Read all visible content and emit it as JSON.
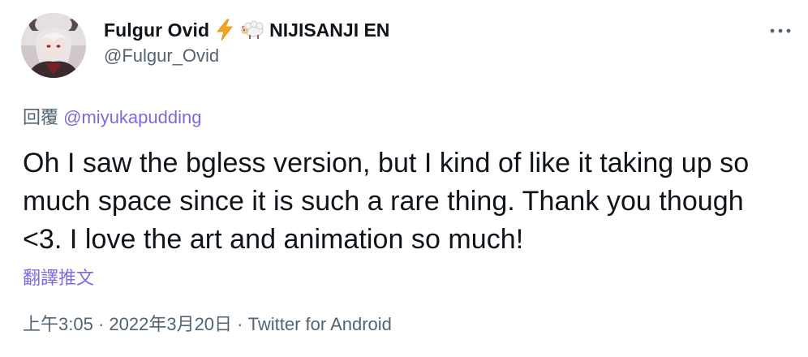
{
  "tweet": {
    "author": {
      "display_name": "Fulgur Ovid",
      "emojis": [
        "lightning-emoji",
        "sheep-emoji"
      ],
      "org_name": "NIJISANJI EN",
      "handle": "@Fulgur_Ovid",
      "avatar": "avatar-image"
    },
    "more_icon": "more-horizontal-icon",
    "reply": {
      "prefix": "回覆",
      "mention": "@miyukapudding"
    },
    "text": "Oh I saw the bgless version, but I kind of like it taking up so much space since it is such a rare thing. Thank you though <3. I love the art and animation so much!",
    "translate_label": "翻譯推文",
    "meta": {
      "time": "上午3:05",
      "separator": " · ",
      "date": "2022年3月20日",
      "source": "Twitter for Android"
    },
    "colors": {
      "text": "#0f1419",
      "secondary": "#536471",
      "link": "#8068e0"
    }
  }
}
